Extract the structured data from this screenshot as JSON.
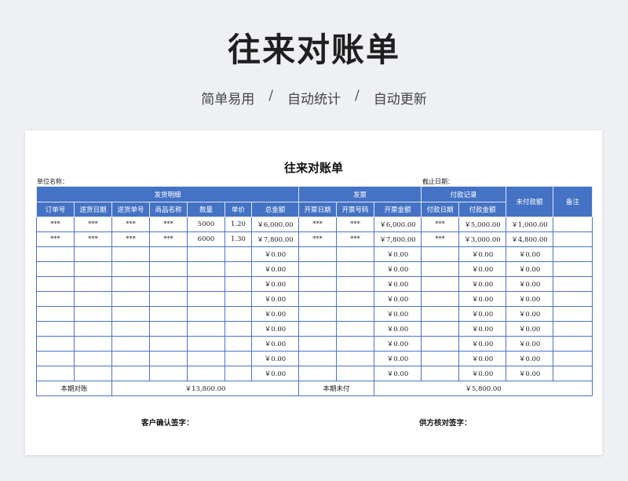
{
  "header": {
    "title": "往来对账单",
    "tags": [
      "简单易用",
      "自动统计",
      "自动更新"
    ],
    "separator": "/"
  },
  "sheet": {
    "title": "往来对账单",
    "unit_label": "单位名称：",
    "cutoff_label": "截止日期：",
    "groups": {
      "shipment": "发货明细",
      "invoice": "发票",
      "payment": "付款记录",
      "unpaid": "未付款额",
      "remark": "备注"
    },
    "columns": [
      "订单号",
      "送货日期",
      "送货单号",
      "商品名称",
      "数量",
      "单价",
      "总金额",
      "开票日期",
      "开票号码",
      "开票金额",
      "付款日期",
      "付款金额"
    ],
    "rows": [
      {
        "order": "***",
        "date": "***",
        "delivery_no": "***",
        "product": "***",
        "qty": "5000",
        "price": "1.20",
        "total": "￥6,000.00",
        "inv_date": "***",
        "inv_no": "***",
        "inv_amount": "￥6,000.00",
        "pay_date": "***",
        "pay_amount": "￥5,000.00",
        "unpaid": "￥1,000.00",
        "remark": ""
      },
      {
        "order": "***",
        "date": "***",
        "delivery_no": "***",
        "product": "***",
        "qty": "6000",
        "price": "1.30",
        "total": "￥7,800.00",
        "inv_date": "***",
        "inv_no": "***",
        "inv_amount": "￥7,800.00",
        "pay_date": "***",
        "pay_amount": "￥3,000.00",
        "unpaid": "￥4,800.00",
        "remark": ""
      },
      {
        "order": "",
        "date": "",
        "delivery_no": "",
        "product": "",
        "qty": "",
        "price": "",
        "total": "￥0.00",
        "inv_date": "",
        "inv_no": "",
        "inv_amount": "￥0.00",
        "pay_date": "",
        "pay_amount": "￥0.00",
        "unpaid": "￥0.00",
        "remark": ""
      },
      {
        "order": "",
        "date": "",
        "delivery_no": "",
        "product": "",
        "qty": "",
        "price": "",
        "total": "￥0.00",
        "inv_date": "",
        "inv_no": "",
        "inv_amount": "￥0.00",
        "pay_date": "",
        "pay_amount": "￥0.00",
        "unpaid": "￥0.00",
        "remark": ""
      },
      {
        "order": "",
        "date": "",
        "delivery_no": "",
        "product": "",
        "qty": "",
        "price": "",
        "total": "￥0.00",
        "inv_date": "",
        "inv_no": "",
        "inv_amount": "￥0.00",
        "pay_date": "",
        "pay_amount": "￥0.00",
        "unpaid": "￥0.00",
        "remark": ""
      },
      {
        "order": "",
        "date": "",
        "delivery_no": "",
        "product": "",
        "qty": "",
        "price": "",
        "total": "￥0.00",
        "inv_date": "",
        "inv_no": "",
        "inv_amount": "￥0.00",
        "pay_date": "",
        "pay_amount": "￥0.00",
        "unpaid": "￥0.00",
        "remark": ""
      },
      {
        "order": "",
        "date": "",
        "delivery_no": "",
        "product": "",
        "qty": "",
        "price": "",
        "total": "￥0.00",
        "inv_date": "",
        "inv_no": "",
        "inv_amount": "￥0.00",
        "pay_date": "",
        "pay_amount": "￥0.00",
        "unpaid": "￥0.00",
        "remark": ""
      },
      {
        "order": "",
        "date": "",
        "delivery_no": "",
        "product": "",
        "qty": "",
        "price": "",
        "total": "￥0.00",
        "inv_date": "",
        "inv_no": "",
        "inv_amount": "￥0.00",
        "pay_date": "",
        "pay_amount": "￥0.00",
        "unpaid": "￥0.00",
        "remark": ""
      },
      {
        "order": "",
        "date": "",
        "delivery_no": "",
        "product": "",
        "qty": "",
        "price": "",
        "total": "￥0.00",
        "inv_date": "",
        "inv_no": "",
        "inv_amount": "￥0.00",
        "pay_date": "",
        "pay_amount": "￥0.00",
        "unpaid": "￥0.00",
        "remark": ""
      },
      {
        "order": "",
        "date": "",
        "delivery_no": "",
        "product": "",
        "qty": "",
        "price": "",
        "total": "￥0.00",
        "inv_date": "",
        "inv_no": "",
        "inv_amount": "￥0.00",
        "pay_date": "",
        "pay_amount": "￥0.00",
        "unpaid": "￥0.00",
        "remark": ""
      },
      {
        "order": "",
        "date": "",
        "delivery_no": "",
        "product": "",
        "qty": "",
        "price": "",
        "total": "￥0.00",
        "inv_date": "",
        "inv_no": "",
        "inv_amount": "￥0.00",
        "pay_date": "",
        "pay_amount": "￥0.00",
        "unpaid": "￥0.00",
        "remark": ""
      }
    ],
    "footer": {
      "period_label": "本期对账",
      "period_total": "￥13,800.00",
      "unpaid_label": "本期未付",
      "unpaid_total": "￥5,800.00"
    },
    "signatures": {
      "customer": "客户确认签字：",
      "supplier": "供方核对签字："
    }
  },
  "colors": {
    "header_blue": "#4472c4",
    "border_blue": "#4a72c8",
    "background": "#eef0f4"
  }
}
